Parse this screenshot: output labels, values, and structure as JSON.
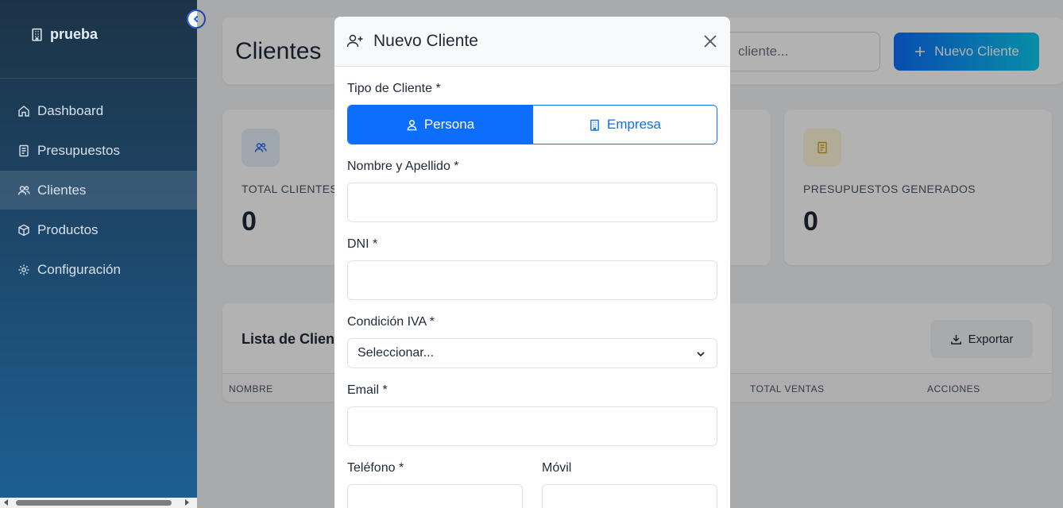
{
  "sidebar": {
    "brand": "prueba",
    "items": [
      {
        "label": "Dashboard",
        "icon": "home-icon"
      },
      {
        "label": "Presupuestos",
        "icon": "document-icon"
      },
      {
        "label": "Clientes",
        "icon": "users-icon",
        "active": true
      },
      {
        "label": "Productos",
        "icon": "box-icon"
      },
      {
        "label": "Configuración",
        "icon": "gear-icon"
      }
    ]
  },
  "header": {
    "title": "Clientes",
    "search_value": "cliente...",
    "new_button": "Nuevo Cliente"
  },
  "stats": [
    {
      "label": "TOTAL CLIENTES",
      "value": "0",
      "icon": "users-icon",
      "color": "#e6eef8"
    },
    {
      "label": "PRESUPUESTOS GENERADOS",
      "value": "0",
      "icon": "document-icon",
      "color": "#fdf6d8"
    }
  ],
  "list": {
    "title": "Lista de Clientes",
    "export_button": "Exportar",
    "columns": [
      "NOMBRE",
      "TOTAL VENTAS",
      "ACCIONES"
    ]
  },
  "modal": {
    "title": "Nuevo Cliente",
    "client_type_label": "Tipo de Cliente *",
    "type_options": [
      "Persona",
      "Empresa"
    ],
    "selected_type": "Persona",
    "name_label": "Nombre y Apellido *",
    "dni_label": "DNI *",
    "iva_label": "Condición IVA *",
    "iva_value": "Seleccionar...",
    "email_label": "Email *",
    "phone_label": "Teléfono *",
    "mobile_label": "Móvil"
  },
  "colors": {
    "primary": "#0d6efd",
    "sidebar_top": "#1c3347",
    "sidebar_bottom": "#1d5f92"
  }
}
